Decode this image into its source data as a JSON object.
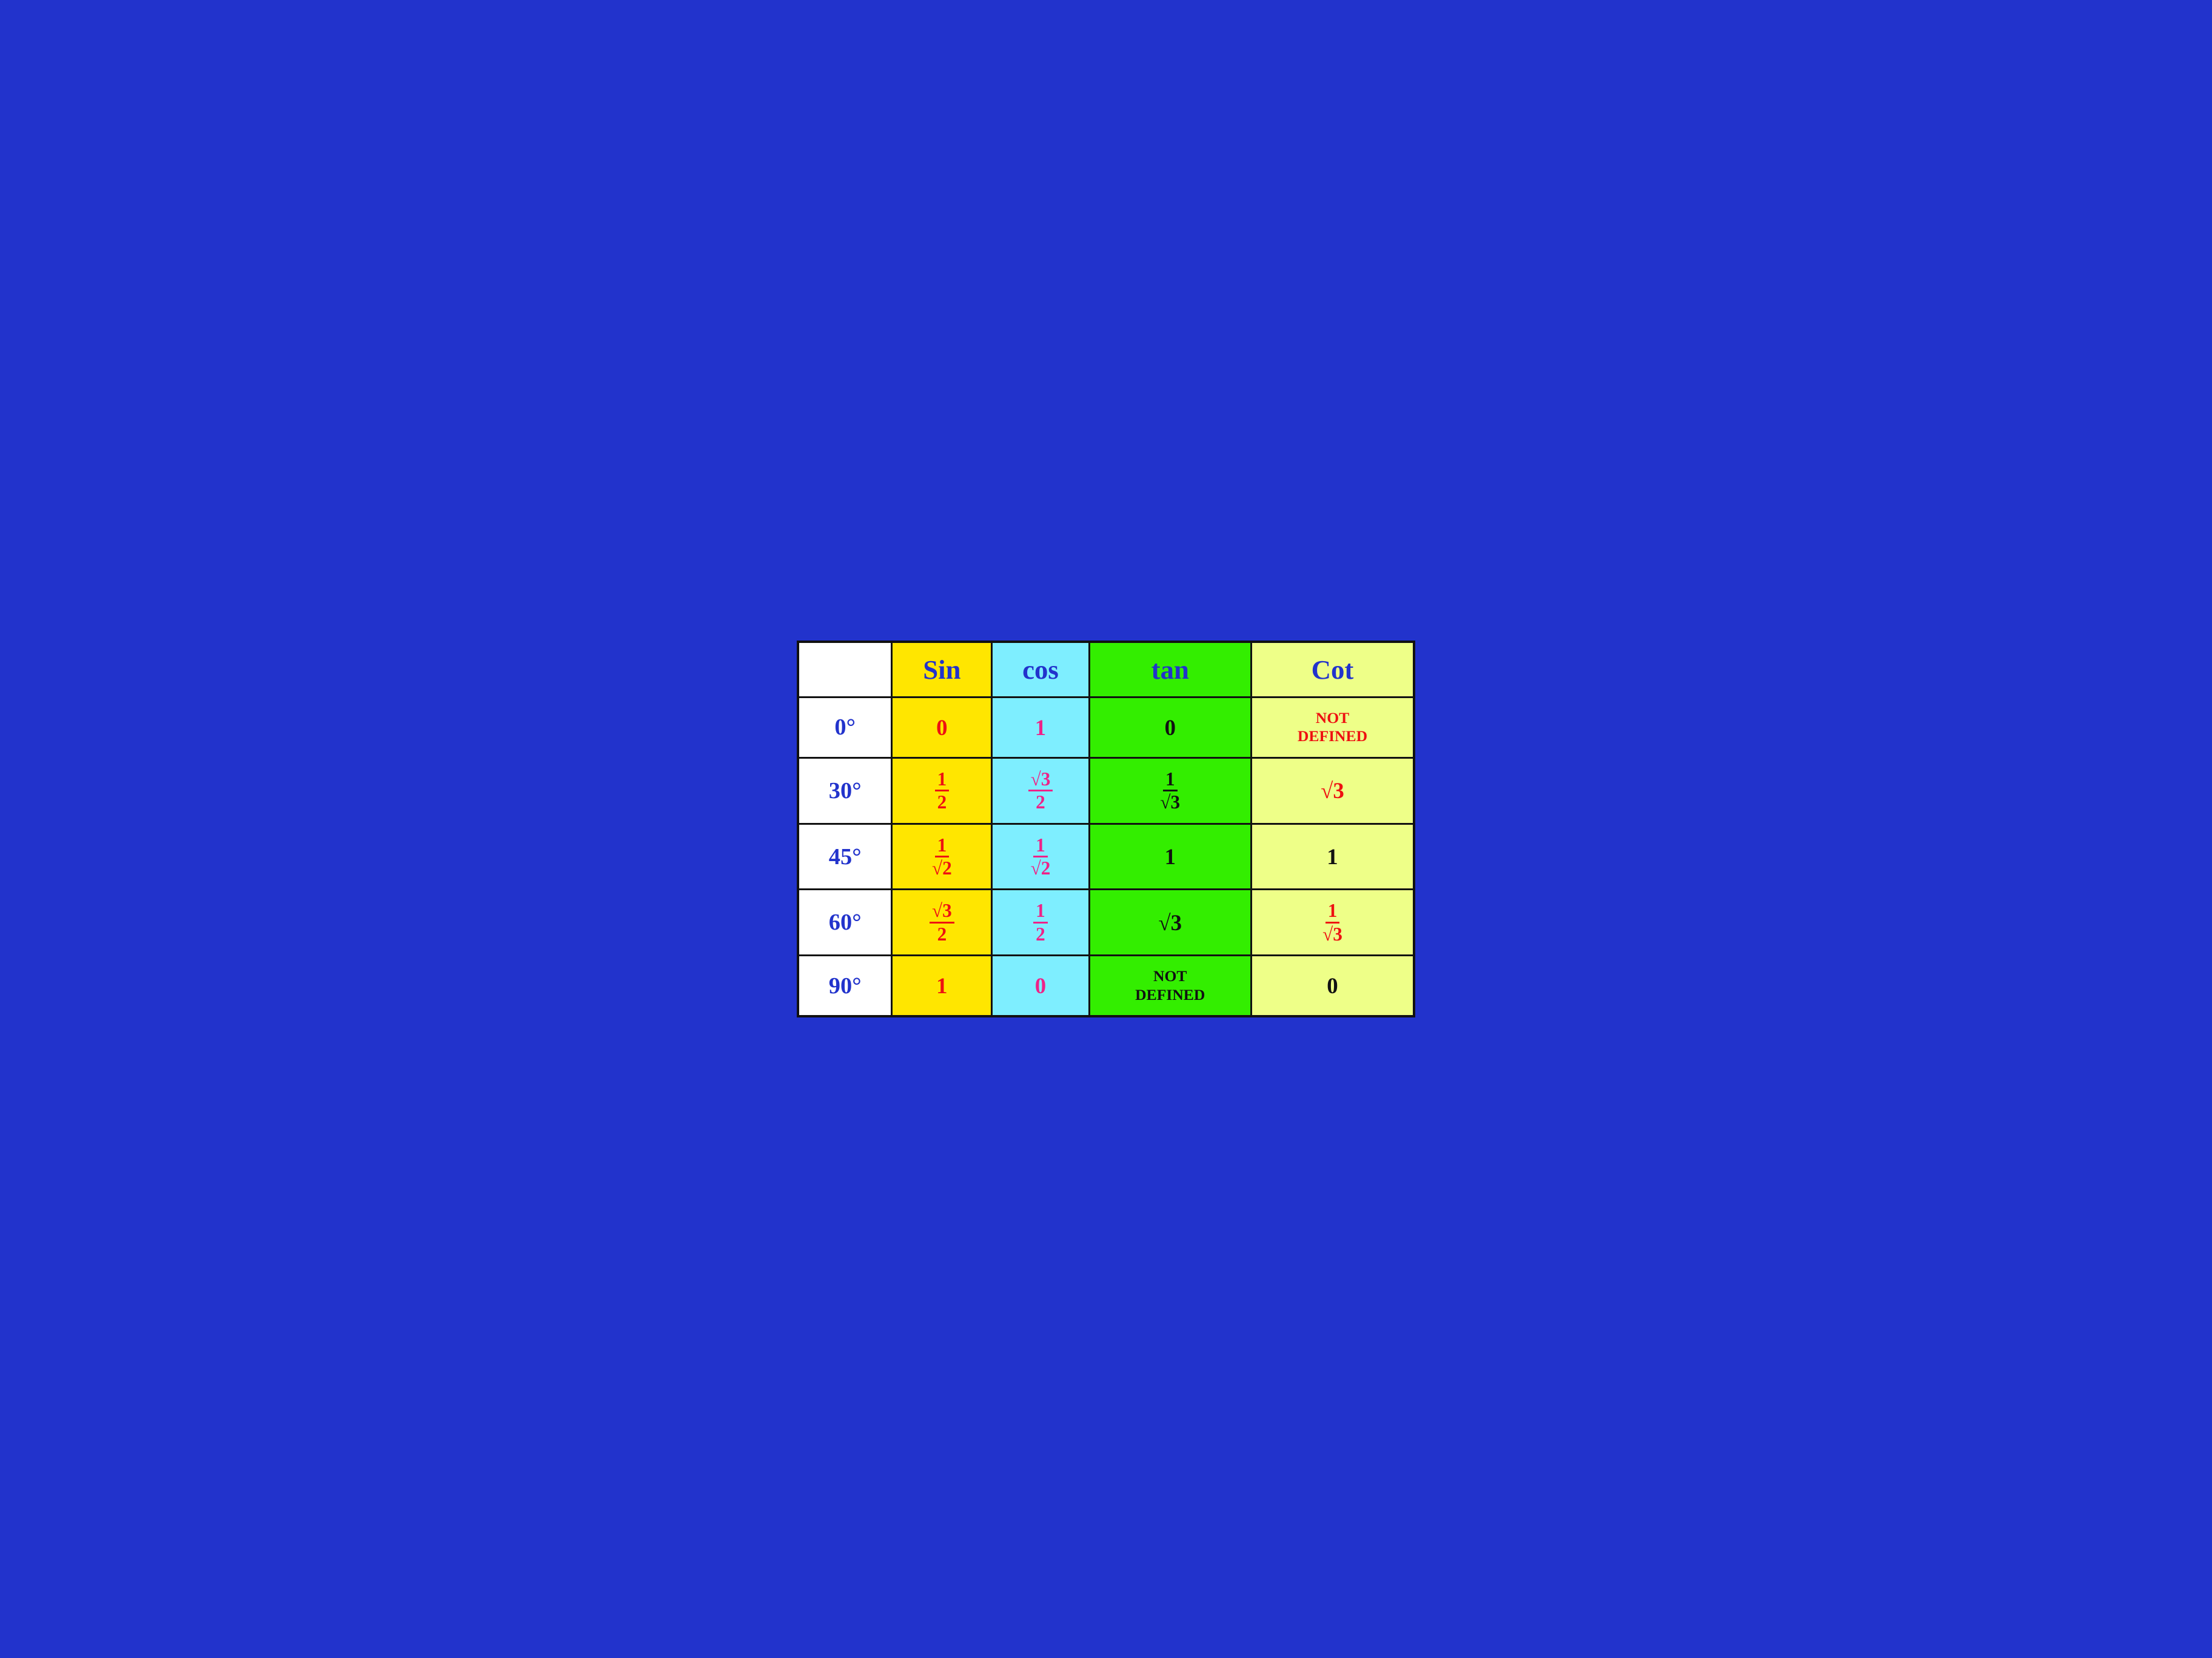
{
  "table": {
    "headers": {
      "empty": "",
      "sin": "Sin",
      "cos": "cos",
      "tan": "tan",
      "cot": "Cot"
    },
    "rows": [
      {
        "angle": "0°",
        "sin": "0",
        "cos": "1",
        "tan": "0",
        "cot": "Not Defined"
      },
      {
        "angle": "30°",
        "sin": "½",
        "cos": "√3/2",
        "tan": "1/√3",
        "cot": "√3"
      },
      {
        "angle": "45°",
        "sin": "1/√2",
        "cos": "1/√2",
        "tan": "1",
        "cot": "1"
      },
      {
        "angle": "60°",
        "sin": "√3/2",
        "cos": "½",
        "tan": "√3",
        "cot": "1/√3"
      },
      {
        "angle": "90°",
        "sin": "1",
        "cos": "0",
        "tan": "Not Defined",
        "cot": "0"
      }
    ]
  }
}
